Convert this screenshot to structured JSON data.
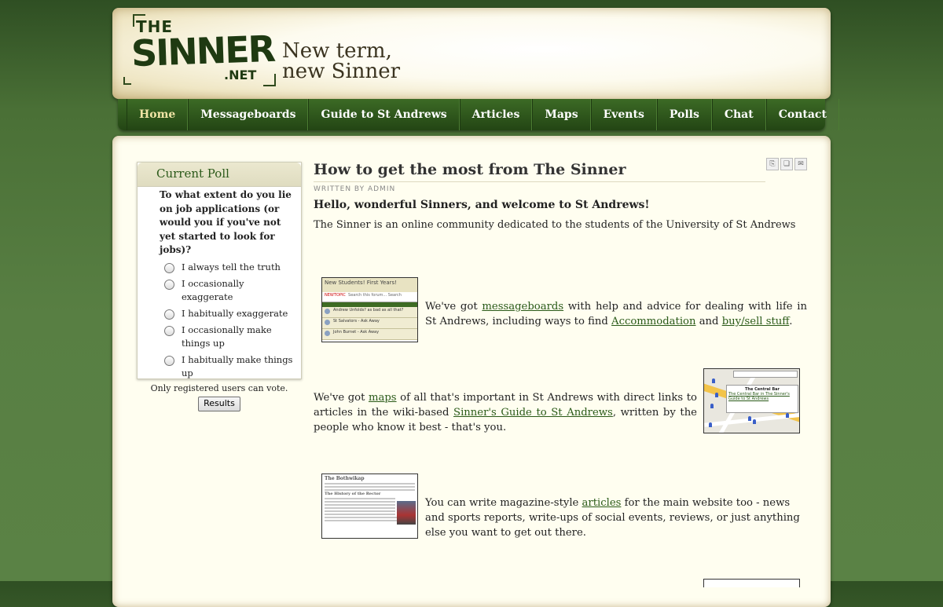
{
  "site": {
    "logo_the": "THE",
    "logo_sinner": "SINNER",
    "logo_net": ".NET",
    "tagline_line1": "New term,",
    "tagline_line2": "new Sinner"
  },
  "nav": {
    "items": [
      {
        "label": "Home"
      },
      {
        "label": "Messageboards"
      },
      {
        "label": "Guide to St Andrews"
      },
      {
        "label": "Articles"
      },
      {
        "label": "Maps"
      },
      {
        "label": "Events"
      },
      {
        "label": "Polls"
      },
      {
        "label": "Chat"
      },
      {
        "label": "Contact"
      }
    ],
    "active": "Home"
  },
  "poll": {
    "title": "Current Poll",
    "question": "To what extent do you lie on job applications (or would you if you've not yet started to look for jobs)?",
    "options": [
      "I always tell the truth",
      "I occasionally exaggerate",
      "I habitually exaggerate",
      "I occasionally make things up",
      "I habitually make things up"
    ],
    "note": "Only registered users can vote.",
    "results_label": "Results"
  },
  "article": {
    "title": "How to get the most from The Sinner",
    "byline": "Written by Admin",
    "intro": "Hello, wonderful Sinners, and welcome to St Andrews!",
    "para1": "The Sinner is an online community dedicated to the students of the University of St Andrews",
    "icon_pdf": "pdf-icon",
    "icon_print": "print-icon",
    "icon_email": "email-icon"
  },
  "feature1": {
    "t1": "We've got ",
    "link1": "messageboards",
    "t2": " with help and advice for dealing with life in St Andrews, including ways to find ",
    "link2": "Accommodation",
    "t3": " and ",
    "link3": "buy/sell stuff",
    "t4": ".",
    "thumb_title": "New Students! First Years!",
    "thumb_newtopic": "NEWTOPIC",
    "thumb_search": "Search this forum... Search",
    "thumb_topics": "TOPICS",
    "thumb_rows": [
      "Andrew Unfolds? as bad as all that?",
      "St Salvators - Ask Away",
      "John Burnet - Ask Away"
    ]
  },
  "feature2": {
    "t1": "We've got ",
    "link1": "maps",
    "t2": " of all that's important in St Andrews with direct links to articles in the wiki-based ",
    "link2": "Sinner's Guide to St Andrews",
    "t3": ", written by the people who know it best - that's you.",
    "bubble_title": "The Central Bar",
    "bubble_text": "The Central Bar in The Sinner's Guide to St Andrews"
  },
  "feature3": {
    "t1": "You can write magazine-style ",
    "link1": "articles",
    "t2": " for the main website too - news and sports reports, write-ups of social events, reviews, or just anything else you want to get out there.",
    "thumb_title": "The Bothwikap",
    "thumb_subtitle": "The History of the Rector"
  },
  "colors": {
    "background": "#4a7036",
    "nav": "#2d5a1b",
    "accent_link": "#2a5a18",
    "panel": "#fffef0"
  }
}
